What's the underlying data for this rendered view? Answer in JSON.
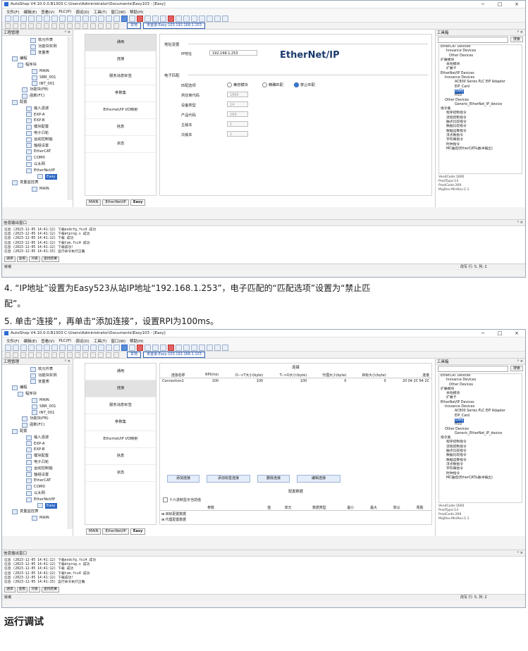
{
  "app": {
    "title": "AutoShop V4.10.0.0.B1303  C:\\Users\\Administrator\\Documents\\Easy103 - [Easy]",
    "menu": [
      "文件(F)",
      "编辑(E)",
      "查看(V)",
      "PLC(P)",
      "调试(D)",
      "工具(T)",
      "窗口(W)",
      "帮助(H)"
    ],
    "toolbar_local": "本地",
    "toolbar_login": "未登录:Easy-103.192.168.1.103"
  },
  "project_panel": {
    "title": "工程管理",
    "items": [
      "软元件表",
      "功能块实例",
      "变量表",
      "编程",
      "程序块",
      "MAIN",
      "SBR_001",
      "INT_001",
      "功能块(FB)",
      "函数(FC)",
      "配置",
      "输入滤波",
      "EXP-A",
      "EXP-B",
      "模块配置",
      "电子凸轮",
      "运动控制轴",
      "轴组设置",
      "EtherCAT",
      "COM0",
      "以太网",
      "EtherNet/IP",
      "Easy",
      "变量监控表",
      "MAIN"
    ]
  },
  "editor_tabs": [
    "MAIN",
    "EtherNet/IP",
    "Easy"
  ],
  "sidenav": [
    "通用",
    "连接",
    "服务消息标签",
    "参数集",
    "Ethernet/IP I/O映射",
    "信息",
    "状态"
  ],
  "general": {
    "addr_section": "地址设置",
    "ip_label": "IP地址",
    "ip_value": "192.168.1.253",
    "logo": "EtherNet/IP",
    "ematch_section": "电子匹配",
    "match_label": "匹配选项",
    "opt_compat": "兼容模块",
    "opt_exact": "精确匹配",
    "opt_disable": "禁止匹配",
    "vendor_label": "供应商代码",
    "vendor_value": "1660",
    "devtype_label": "设备类型",
    "devtype_value": "14",
    "prodcode_label": "产品代码",
    "prodcode_value": "269",
    "major_label": "主版本",
    "major_value": "1",
    "minor_label": "次版本",
    "minor_value": "1"
  },
  "connection": {
    "title": "连接",
    "headers": [
      "连接名称",
      "RPI(ms)",
      "O-->T大小(byte)",
      "T-->O大小(byte)",
      "代理大小(byte)",
      "目标大小(byte)",
      "连接"
    ],
    "row": [
      "Connection1",
      "100",
      "100",
      "100",
      "0",
      "0",
      "20 04 2C 64 2C"
    ],
    "buttons": [
      "添加连接",
      "添加标签连接",
      "删除连接",
      "编辑连接"
    ],
    "cfg_title": "配置数据",
    "hex_label": "十六进制显示当前值",
    "param_headers": [
      "参数",
      "值",
      "单元",
      "数据类型",
      "最小",
      "最大",
      "默认",
      "帮助"
    ],
    "param_rows": [
      "目标配置数据",
      "代理配置数据"
    ]
  },
  "toolbox": {
    "title": "工具箱",
    "search": "搜索",
    "items": [
      "EtherCAT Devices",
      "Inovance Devices",
      "Other Devices",
      "扩展模块",
      "本地模块",
      "扩展卡",
      "EtherNet/IP Devices",
      "Inovance Devices",
      "AC800 Series PLC EIP Adapter",
      "EIP_Card",
      "Easy",
      "H5U",
      "Other Devices",
      "Generic_EtherNet_IP_device",
      "指令集",
      "程序控制指令",
      "流程控制指令",
      "触点比较指令",
      "数据比较指令",
      "数据运算指令",
      "浮点数指令",
      "字符串指令",
      "时钟指令",
      "MC轴控(EtherCAT&脉冲输出)"
    ],
    "info": [
      "VendCode:1660",
      "ProdType:14",
      "ProdCode:269",
      "MajRev-MinRev:1-1"
    ]
  },
  "output": {
    "title": "信息输出窗口",
    "lines": [
      "信息  (2023-12-05 14:41:12)  下载evdcfg.fsi4 成功",
      "信息  (2023-12-05 14:41:12)  下载etprog.s 成功",
      "信息  (2023-12-05 14:41:12)  下载 成功",
      "信息  (2023-12-05 14:41:12)  下载tsm.fsi4 成功",
      "信息  (2023-12-05 14:41:12)  下载成功!",
      "信息  (2023-12-05 14:41:15)  运行命令执行正确"
    ],
    "tabs": [
      "通译",
      "查看",
      "对表",
      "查找结果"
    ]
  },
  "status": {
    "left": "就绪",
    "right": "改写  行: 5, 列: 2"
  },
  "doc": {
    "step4": "4. “IP地址”设置为Easy523从站IP地址“192.168.1.253”，电子匹配的“匹配选项”设置为“禁止匹",
    "step4b": "   配”。",
    "step5": "5. 单击“连接”，再单击“添加连接”，设置RPI为100ms。",
    "heading": "运行调试"
  }
}
